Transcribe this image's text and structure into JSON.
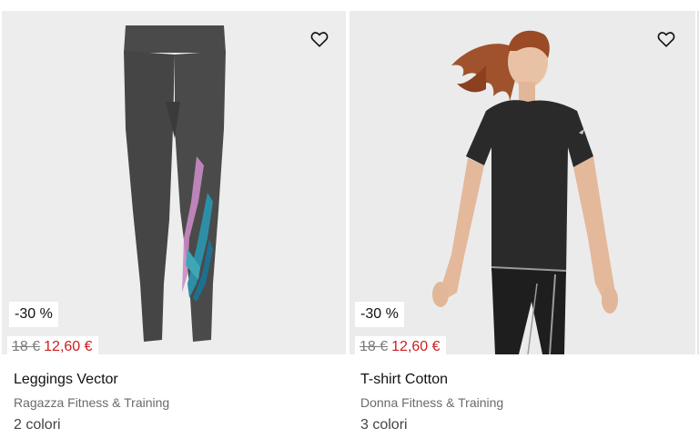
{
  "products": [
    {
      "discount_badge": "-30 %",
      "old_price": "18 €",
      "new_price": "12,60 €",
      "name": "Leggings Vector",
      "category": "Ragazza Fitness & Training",
      "colors": "2 colori",
      "favorite_icon": "heart-outline-icon"
    },
    {
      "discount_badge": "-30 %",
      "old_price": "18 €",
      "new_price": "12,60 €",
      "name": "T-shirt Cotton",
      "category": "Donna Fitness & Training",
      "colors": "3 colori",
      "favorite_icon": "heart-outline-icon"
    }
  ]
}
